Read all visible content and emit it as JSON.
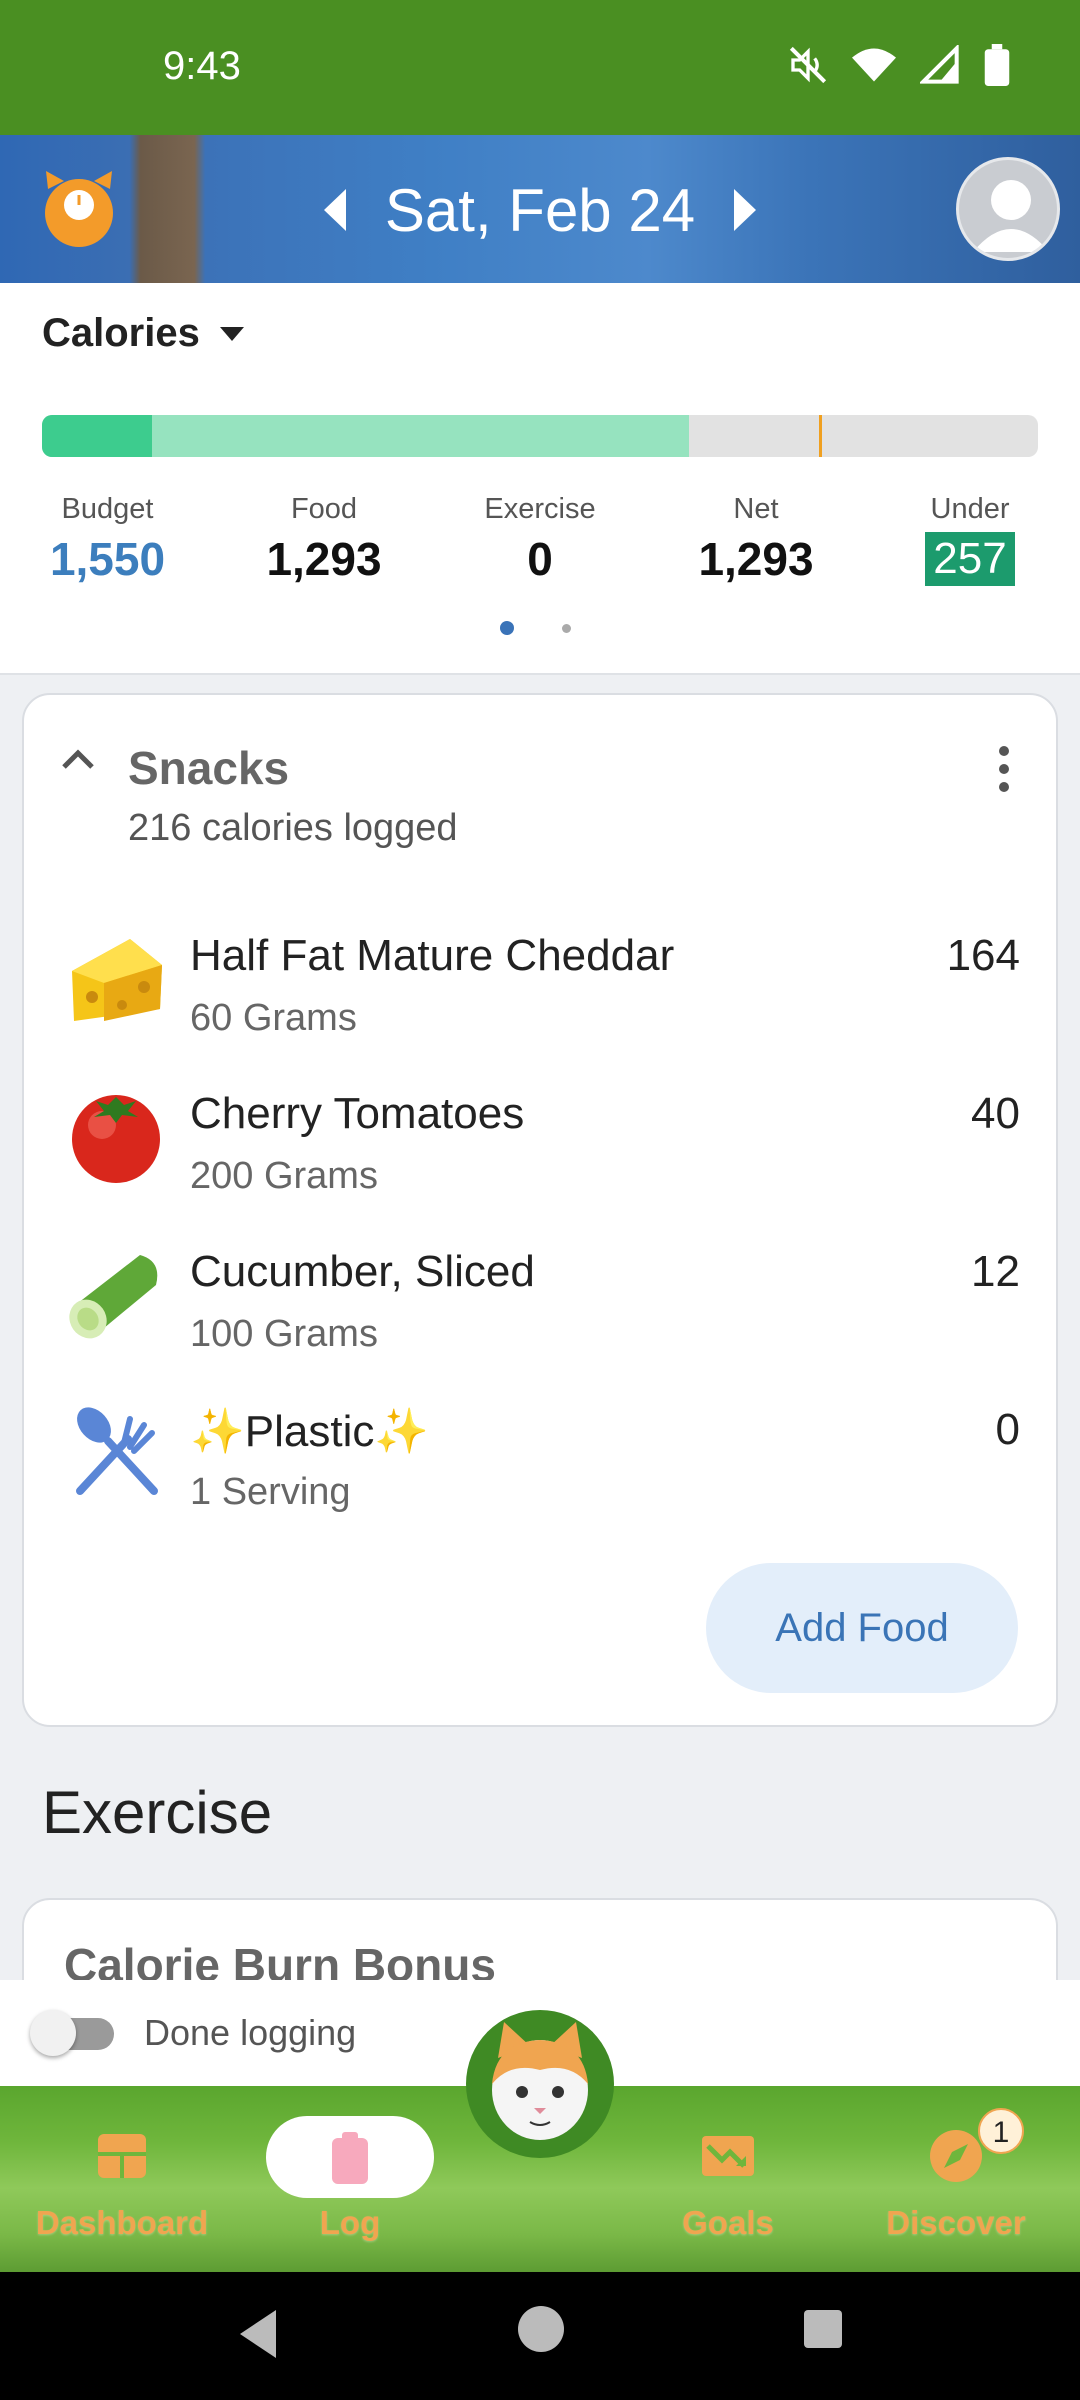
{
  "status_bar": {
    "time": "9:43"
  },
  "header": {
    "date": "Sat, Feb 24"
  },
  "summary": {
    "metric": "Calories",
    "progress": {
      "budget": 1550,
      "food": 1293,
      "food_fraction_of_scale": 0.65,
      "marker_fraction": 0.78,
      "dark_fraction": 0.11
    },
    "stats": [
      {
        "label": "Budget",
        "value": "1,550"
      },
      {
        "label": "Food",
        "value": "1,293"
      },
      {
        "label": "Exercise",
        "value": "0"
      },
      {
        "label": "Net",
        "value": "1,293"
      },
      {
        "label": "Under",
        "value": "257"
      }
    ],
    "pager": {
      "current": 1,
      "total": 2
    }
  },
  "snacks": {
    "title": "Snacks",
    "subtitle": "216 calories logged",
    "items": [
      {
        "name": "Half Fat Mature Cheddar",
        "qty": "60 Grams",
        "calories": "164",
        "icon": "cheese-icon"
      },
      {
        "name": "Cherry Tomatoes",
        "qty": "200 Grams",
        "calories": "40",
        "icon": "tomato-icon"
      },
      {
        "name": "Cucumber, Sliced",
        "qty": "100 Grams",
        "calories": "12",
        "icon": "cucumber-icon"
      },
      {
        "name": "✨Plastic✨",
        "qty": "1 Serving",
        "calories": "0",
        "icon": "fork-spoon-icon"
      }
    ],
    "add_food_label": "Add Food"
  },
  "exercise": {
    "heading": "Exercise",
    "card_title": "Calorie Burn Bonus"
  },
  "done_logging": {
    "label": "Done logging",
    "enabled": false
  },
  "bottom_nav": {
    "items": [
      {
        "label": "Dashboard",
        "icon": "dashboard-icon"
      },
      {
        "label": "Log",
        "icon": "clipboard-icon",
        "active": true
      },
      {
        "label": "Goals",
        "icon": "goals-chart-icon"
      },
      {
        "label": "Discover",
        "icon": "compass-icon",
        "badge": "1"
      }
    ]
  },
  "colors": {
    "status_bar": "#4a8f22",
    "accent_blue": "#3c7ebd",
    "under_badge": "#1c9b6d",
    "nav_label": "#f0a550",
    "progress_food": "#96e3bf",
    "progress_dark": "#3dcc8e"
  }
}
